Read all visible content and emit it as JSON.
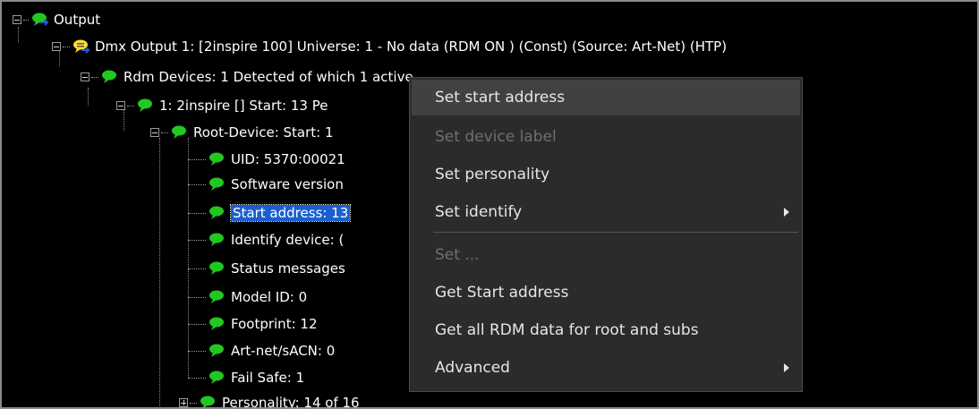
{
  "colors": {
    "bubble_green": "#22c722",
    "bubble_yellow": "#ffdd33",
    "arrow_blue": "#1e5bd6",
    "selection": "#1a5fd0"
  },
  "tree": {
    "output": "Output",
    "dmx_output": "Dmx Output 1: [2inspire 100] Universe: 1  - No data (RDM ON  ) (Const) (Source: Art-Net) (HTP)",
    "rdm_devices": "Rdm Devices: 1 Detected of which 1 active",
    "device": "1: 2inspire [] Start: 13 Pe",
    "root_device": "Root-Device: Start: 1",
    "uid": "UID: 5370:00021",
    "software": "Software version",
    "start_address": "Start address: 13",
    "identify": "Identify device: (",
    "status": "Status messages",
    "model": "Model ID: 0",
    "footprint": "Footprint: 12",
    "artnet": "Art-net/sACN: 0",
    "failsafe": "Fail Safe: 1",
    "personality": "Personality: 14 of 16"
  },
  "menu": {
    "set_start_address": "Set start address",
    "set_device_label": "Set device label",
    "set_personality": "Set personality",
    "set_identify": "Set identify",
    "set_more": "Set ...",
    "get_start_address": "Get Start address",
    "get_all_rdm": "Get all RDM data for root and subs",
    "advanced": "Advanced"
  }
}
